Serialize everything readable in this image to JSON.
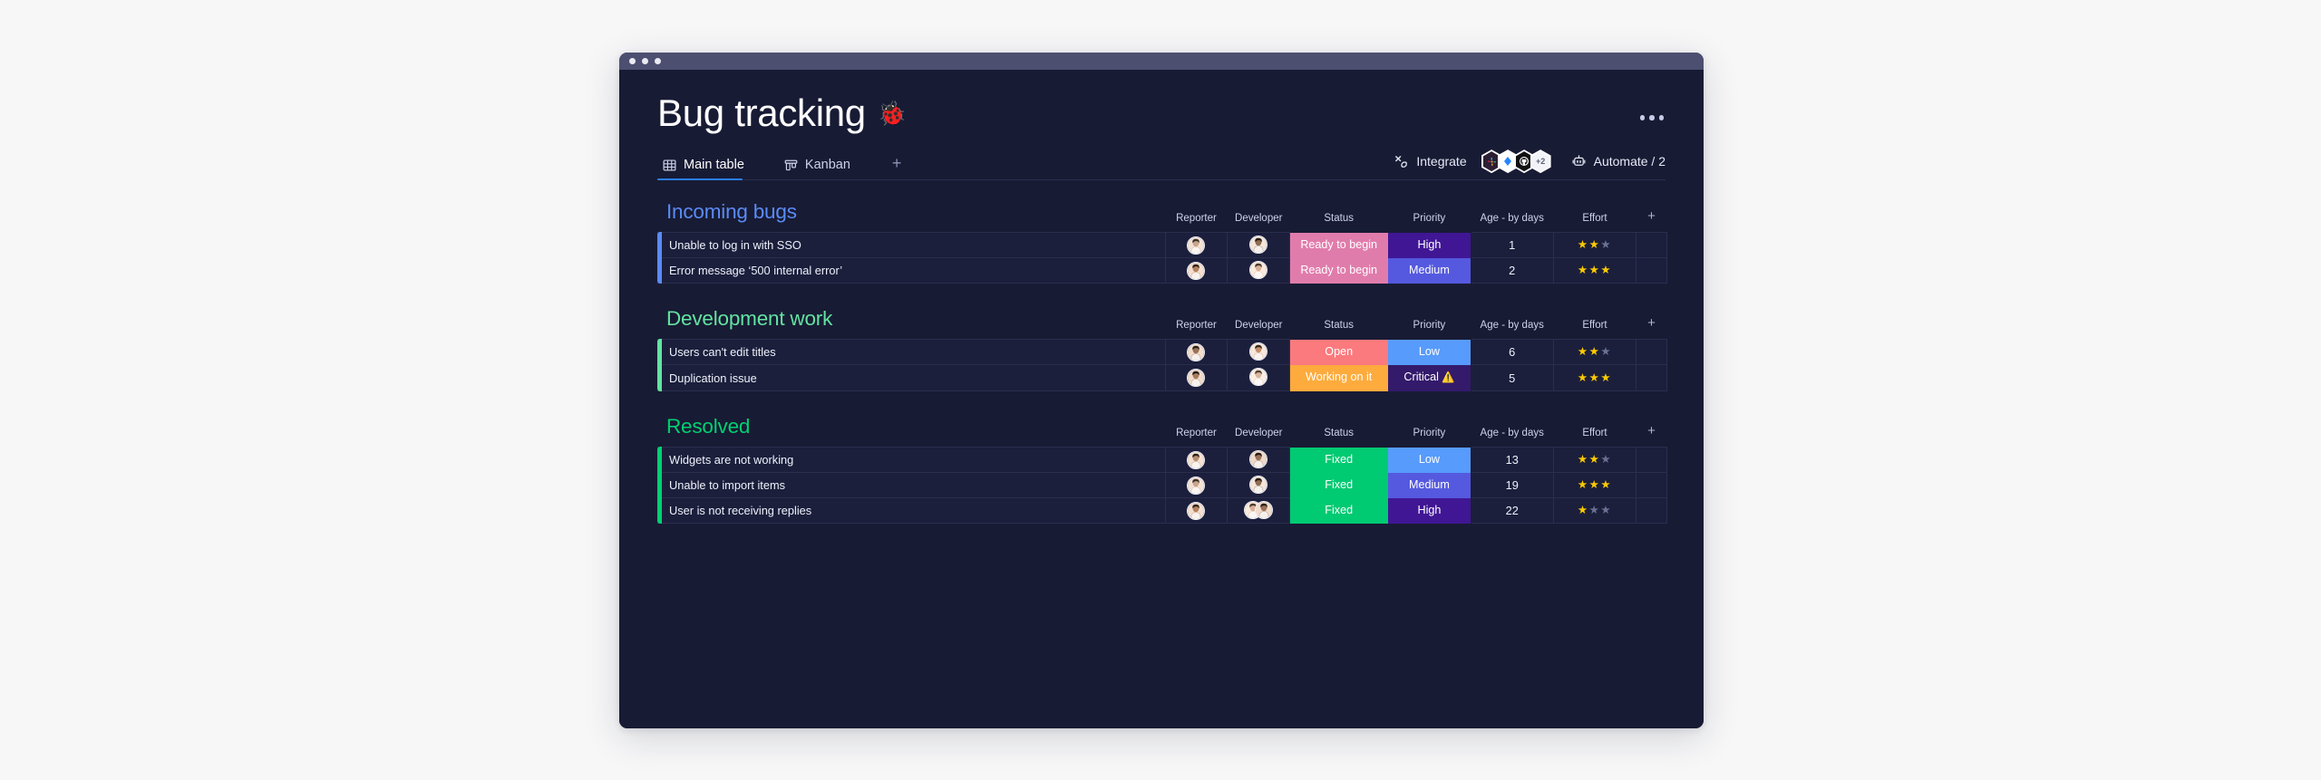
{
  "window": {
    "dots": 3
  },
  "header": {
    "title": "Bug tracking",
    "title_emoji": "🐞",
    "menu_icon": "kebab-menu-icon"
  },
  "tabs": {
    "items": [
      {
        "label": "Main table",
        "icon": "table-grid-icon",
        "active": true
      },
      {
        "label": "Kanban",
        "icon": "kanban-board-icon",
        "active": false
      }
    ],
    "add_label": "+"
  },
  "toolbar": {
    "integrate_label": "Integrate",
    "integrate_icon": "integrate-plug-icon",
    "integrations": [
      {
        "name": "slack-integration-badge",
        "label": ""
      },
      {
        "name": "jira-integration-badge",
        "label": ""
      },
      {
        "name": "github-integration-badge",
        "label": ""
      },
      {
        "name": "more-integrations-badge",
        "label": "+2"
      }
    ],
    "automate_label": "Automate / 2",
    "automate_icon": "robot-icon"
  },
  "table": {
    "columns": [
      "Reporter",
      "Developer",
      "Status",
      "Priority",
      "Age - by days",
      "Effort"
    ],
    "add_column_label": "+"
  },
  "colors": {
    "group_incoming": "#5a8bf5",
    "group_development": "#62e3a1",
    "group_resolved": "#00d071",
    "status_ready": "#e07cab",
    "status_open": "#fb7a7e",
    "status_working": "#fdab3d",
    "status_fixed": "#00ca72",
    "priority_high": "#401694",
    "priority_medium": "#5559df",
    "priority_low": "#579bfc",
    "priority_critical": "#331a6b",
    "star_on": "#ffcb00",
    "star_off": "#6a7193",
    "accent_blue": "#2a7dee"
  },
  "groups": [
    {
      "name": "Incoming bugs",
      "color": "#5a8bf5",
      "rows": [
        {
          "name": "Unable to log in with SSO",
          "reporter": "avatar-reporter",
          "developer": "avatar-developer",
          "developer_count": 1,
          "status": "Ready to begin",
          "status_color": "#e07cab",
          "priority": "High",
          "priority_color": "#401694",
          "priority_warn": false,
          "age": "1",
          "effort": 2,
          "effort_max": 3
        },
        {
          "name": "Error message ‘500 internal error’",
          "reporter": "avatar-reporter",
          "developer": "avatar-developer",
          "developer_count": 1,
          "status": "Ready to begin",
          "status_color": "#e07cab",
          "priority": "Medium",
          "priority_color": "#5559df",
          "priority_warn": false,
          "age": "2",
          "effort": 3,
          "effort_max": 3
        }
      ]
    },
    {
      "name": "Development work",
      "color": "#62e3a1",
      "rows": [
        {
          "name": "Users can't edit titles",
          "reporter": "avatar-reporter",
          "developer": "avatar-developer",
          "developer_count": 1,
          "status": "Open",
          "status_color": "#fb7a7e",
          "priority": "Low",
          "priority_color": "#579bfc",
          "priority_warn": false,
          "age": "6",
          "effort": 2,
          "effort_max": 3
        },
        {
          "name": "Duplication issue",
          "reporter": "avatar-reporter",
          "developer": "avatar-developer",
          "developer_count": 1,
          "status": "Working on it",
          "status_color": "#fdab3d",
          "priority": "Critical",
          "priority_color": "#331a6b",
          "priority_warn": true,
          "age": "5",
          "effort": 3,
          "effort_max": 3
        }
      ]
    },
    {
      "name": "Resolved",
      "color": "#00d071",
      "rows": [
        {
          "name": "Widgets are not working",
          "reporter": "avatar-reporter",
          "developer": "avatar-developer",
          "developer_count": 1,
          "status": "Fixed",
          "status_color": "#00ca72",
          "priority": "Low",
          "priority_color": "#579bfc",
          "priority_warn": false,
          "age": "13",
          "effort": 2,
          "effort_max": 3
        },
        {
          "name": "Unable to import items",
          "reporter": "avatar-reporter",
          "developer": "avatar-developer",
          "developer_count": 1,
          "status": "Fixed",
          "status_color": "#00ca72",
          "priority": "Medium",
          "priority_color": "#5559df",
          "priority_warn": false,
          "age": "19",
          "effort": 3,
          "effort_max": 3
        },
        {
          "name": "User is not receiving replies",
          "reporter": "avatar-reporter",
          "developer": "avatar-developer",
          "developer_count": 2,
          "status": "Fixed",
          "status_color": "#00ca72",
          "priority": "High",
          "priority_color": "#401694",
          "priority_warn": false,
          "age": "22",
          "effort": 1,
          "effort_max": 3
        }
      ]
    }
  ]
}
